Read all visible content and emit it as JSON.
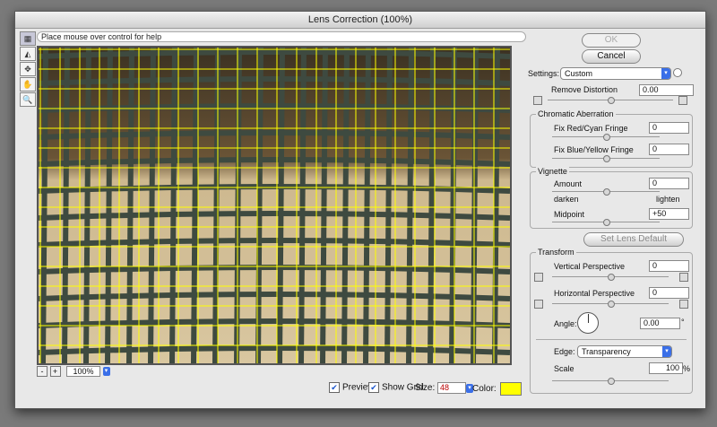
{
  "window": {
    "title": "Lens Correction (100%)"
  },
  "help_text": "Place mouse over control for help",
  "tools": [
    {
      "name": "remove-distortion-tool-icon",
      "glyph": "▦"
    },
    {
      "name": "straighten-tool-icon",
      "glyph": "◭"
    },
    {
      "name": "move-grid-tool-icon",
      "glyph": "✥"
    },
    {
      "name": "hand-tool-icon",
      "glyph": "✋"
    },
    {
      "name": "zoom-tool-icon",
      "glyph": "🔍"
    }
  ],
  "zoom": {
    "minus": "-",
    "plus": "+",
    "value": "100%"
  },
  "bottom": {
    "preview_label": "Preview",
    "show_grid_label": "Show Grid",
    "size_label": "Size:",
    "size_value": "48",
    "color_label": "Color:",
    "grid_color": "#ffff00"
  },
  "buttons": {
    "ok": "OK",
    "cancel": "Cancel",
    "set_lens_default": "Set Lens Default"
  },
  "settings": {
    "label": "Settings:",
    "value": "Custom"
  },
  "remove_distortion": {
    "label": "Remove Distortion",
    "value": "0.00"
  },
  "chromatic": {
    "title": "Chromatic Aberration",
    "red_cyan_label": "Fix Red/Cyan Fringe",
    "red_cyan_value": "0",
    "blue_yellow_label": "Fix Blue/Yellow Fringe",
    "blue_yellow_value": "0"
  },
  "vignette": {
    "title": "Vignette",
    "amount_label": "Amount",
    "amount_value": "0",
    "darken": "darken",
    "lighten": "lighten",
    "midpoint_label": "Midpoint",
    "midpoint_value": "+50"
  },
  "transform": {
    "title": "Transform",
    "vertical_label": "Vertical Perspective",
    "vertical_value": "0",
    "horizontal_label": "Horizontal Perspective",
    "horizontal_value": "0",
    "angle_label": "Angle:",
    "angle_value": "0.00",
    "degree": "°",
    "edge_label": "Edge:",
    "edge_value": "Transparency",
    "scale_label": "Scale",
    "scale_value": "100",
    "percent": "%"
  }
}
